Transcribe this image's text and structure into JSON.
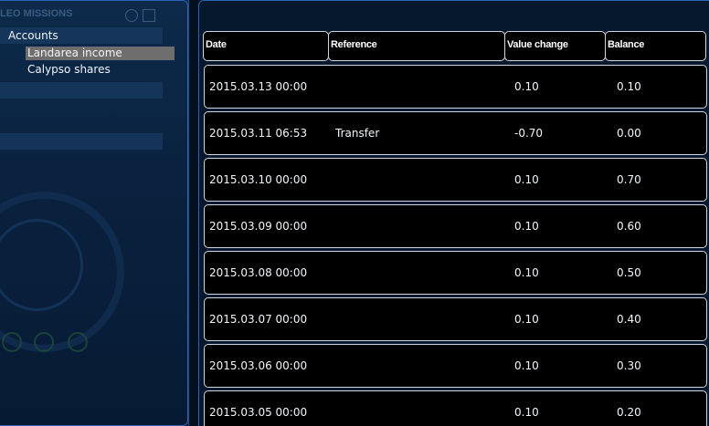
{
  "left": {
    "header": "LEO MISSIONS",
    "accounts_label": "Accounts",
    "accounts": [
      {
        "label": "Landarea income",
        "selected": true
      },
      {
        "label": "Calypso shares",
        "selected": false
      }
    ]
  },
  "table": {
    "columns": [
      "Date",
      "Reference",
      "Value change",
      "Balance"
    ],
    "rows": [
      {
        "date": "2015.03.13 00:00",
        "reference": "",
        "value_change": "0.10",
        "balance": "0.10"
      },
      {
        "date": "2015.03.11 06:53",
        "reference": "Transfer",
        "value_change": "-0.70",
        "balance": "0.00"
      },
      {
        "date": "2015.03.10 00:00",
        "reference": "",
        "value_change": "0.10",
        "balance": "0.70"
      },
      {
        "date": "2015.03.09 00:00",
        "reference": "",
        "value_change": "0.10",
        "balance": "0.60"
      },
      {
        "date": "2015.03.08 00:00",
        "reference": "",
        "value_change": "0.10",
        "balance": "0.50"
      },
      {
        "date": "2015.03.07 00:00",
        "reference": "",
        "value_change": "0.10",
        "balance": "0.40"
      },
      {
        "date": "2015.03.06 00:00",
        "reference": "",
        "value_change": "0.10",
        "balance": "0.30"
      },
      {
        "date": "2015.03.05 00:00",
        "reference": "",
        "value_change": "0.10",
        "balance": "0.20"
      }
    ]
  },
  "colors": {
    "selected_bg": "#6e6e6e",
    "panel_border": "#2a64b5",
    "row_bg": "#000000"
  }
}
